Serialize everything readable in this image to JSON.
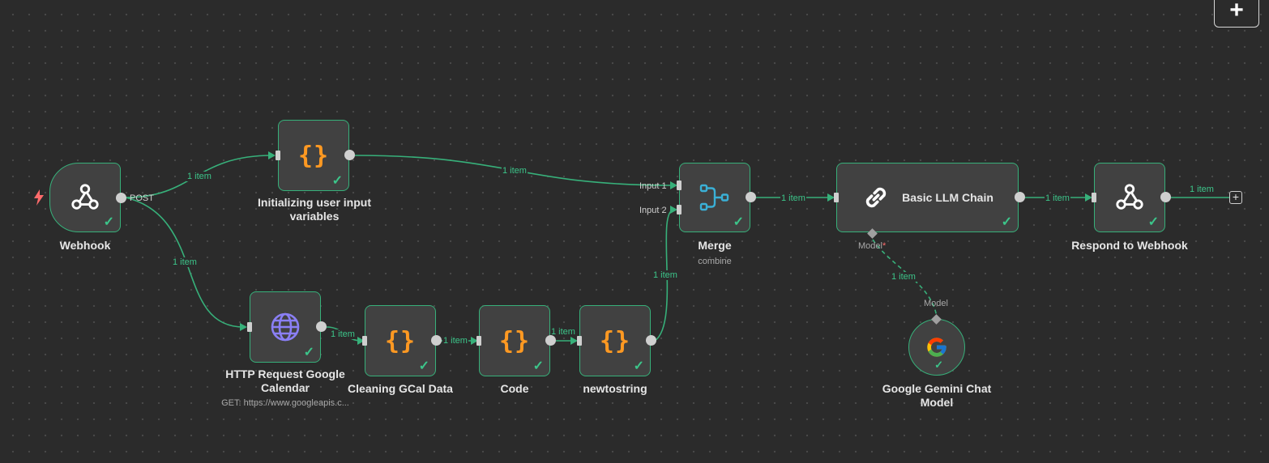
{
  "toolbar": {
    "add_label": "+"
  },
  "nodes": {
    "webhook": {
      "title": "Webhook",
      "output": "POST"
    },
    "init": {
      "title": "Initializing user input variables"
    },
    "http": {
      "title": "HTTP Request Google Calendar",
      "subtitle": "GET: https://www.googleapis.c..."
    },
    "clean": {
      "title": "Cleaning GCal Data"
    },
    "code": {
      "title": "Code"
    },
    "newtostring": {
      "title": "newtostring"
    },
    "merge": {
      "title": "Merge",
      "subtitle": "combine",
      "input1": "Input 1",
      "input2": "Input 2"
    },
    "llm": {
      "title": "Basic LLM Chain",
      "port": "Model",
      "required": "*"
    },
    "respond": {
      "title": "Respond to Webhook"
    },
    "gemini": {
      "title": "Google Gemini Chat Model",
      "port": "Model"
    }
  },
  "edges": {
    "webhook_init": "1 item",
    "webhook_http": "1 item",
    "init_merge": "1 item",
    "http_clean": "1 item",
    "clean_code": "1 item",
    "code_newtostring": "1 item",
    "newtostring_merge": "1 item",
    "merge_llm": "1 item",
    "llm_respond": "1 item",
    "respond_end": "1 item",
    "gemini_llm": "1 item"
  },
  "icons": {
    "code": "braces-icon",
    "webhook": "webhook-icon",
    "http": "globe-icon",
    "merge": "merge-icon",
    "llm": "chain-link-icon",
    "gemini": "google-g-icon",
    "trigger": "lightning-bolt-icon"
  },
  "colors": {
    "canvas": "#2b2b2b",
    "node_fill": "#414141",
    "success": "#37b07a",
    "code_orange": "#ff9922",
    "globe_purple": "#8a7ff5",
    "merge_cyan": "#3ab0d6",
    "trigger_red": "#ff6b6b"
  },
  "status": {
    "check": "✓"
  }
}
